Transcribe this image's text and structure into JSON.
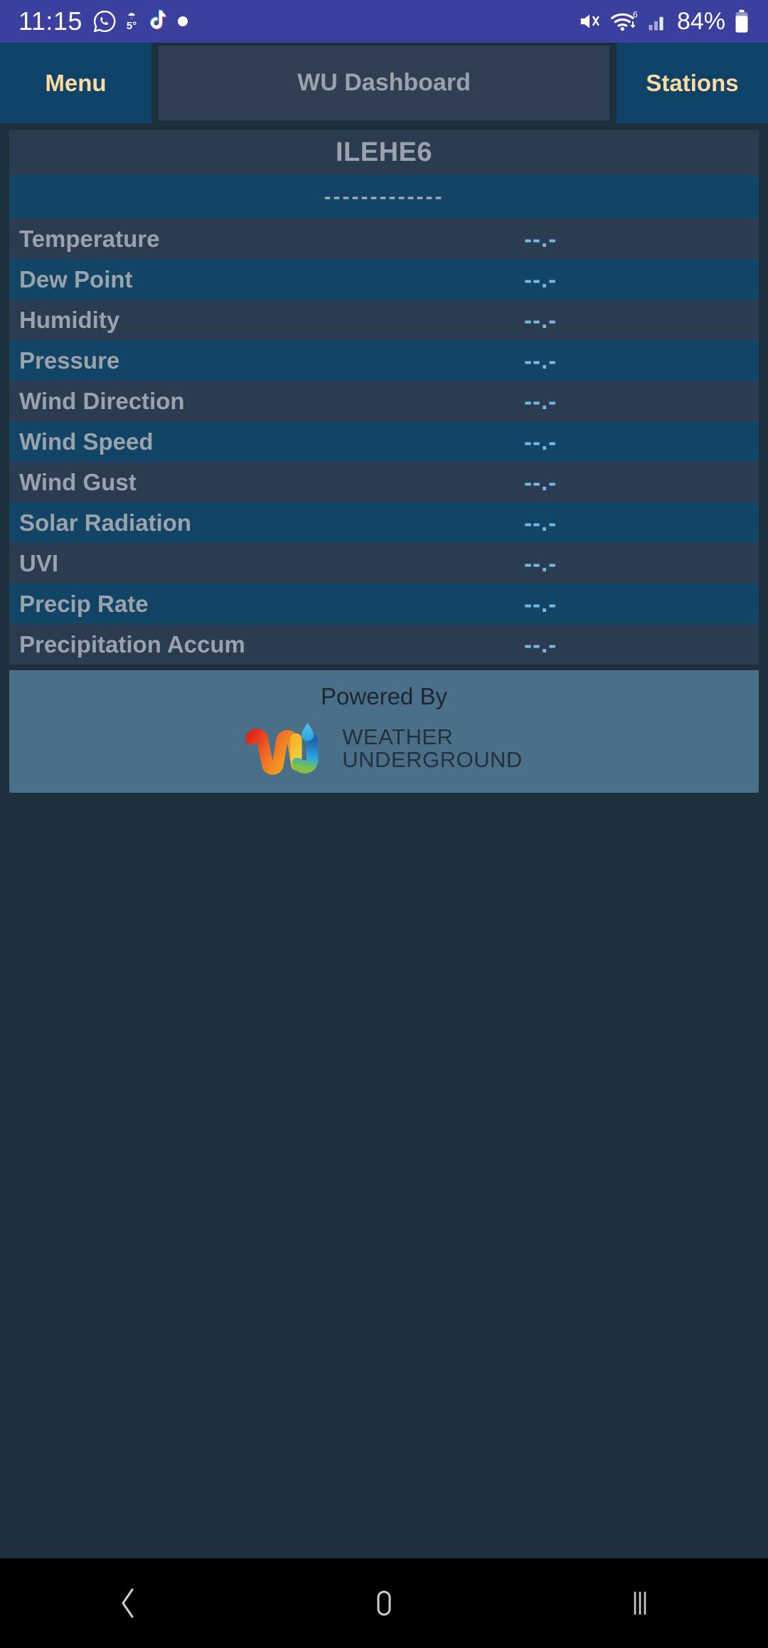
{
  "status_bar": {
    "clock": "11:15",
    "battery_percent": "84%",
    "weather_temp": "5°",
    "icons": [
      "whatsapp-icon",
      "weather-rain-icon",
      "tiktok-icon",
      "dot-indicator-icon",
      "mute-icon",
      "wifi-icon",
      "signal-icon",
      "battery-icon"
    ]
  },
  "topnav": {
    "menu_label": "Menu",
    "title": "WU Dashboard",
    "stations_label": "Stations"
  },
  "station": {
    "name": "ILEHE6",
    "observation_time": "-------------"
  },
  "observations": [
    {
      "label": "Temperature",
      "value": "--.-"
    },
    {
      "label": "Dew Point",
      "value": "--.-"
    },
    {
      "label": "Humidity",
      "value": "--.-"
    },
    {
      "label": "Pressure",
      "value": "--.-"
    },
    {
      "label": "Wind Direction",
      "value": "--.-"
    },
    {
      "label": "Wind Speed",
      "value": "--.-"
    },
    {
      "label": "Wind Gust",
      "value": "--.-"
    },
    {
      "label": "Solar Radiation",
      "value": "--.-"
    },
    {
      "label": "UVI",
      "value": "--.-"
    },
    {
      "label": "Precip Rate",
      "value": "--.-"
    },
    {
      "label": "Precipitation Accum",
      "value": "--.-"
    }
  ],
  "footer": {
    "powered_by": "Powered By",
    "brand_line1": "WEATHER",
    "brand_line2": "UNDERGROUND"
  },
  "android_nav": {
    "back": "back-icon",
    "home": "home-icon",
    "recents": "recents-icon"
  },
  "colors": {
    "status_bar_bg": "#3b3f9e",
    "page_bg": "#1e2f3e",
    "row_even": "#2c3c50",
    "row_odd": "#114465",
    "accent_label": "#ffd9a0",
    "value_blue": "#74b9e7",
    "footer_bg": "#4a7089"
  }
}
